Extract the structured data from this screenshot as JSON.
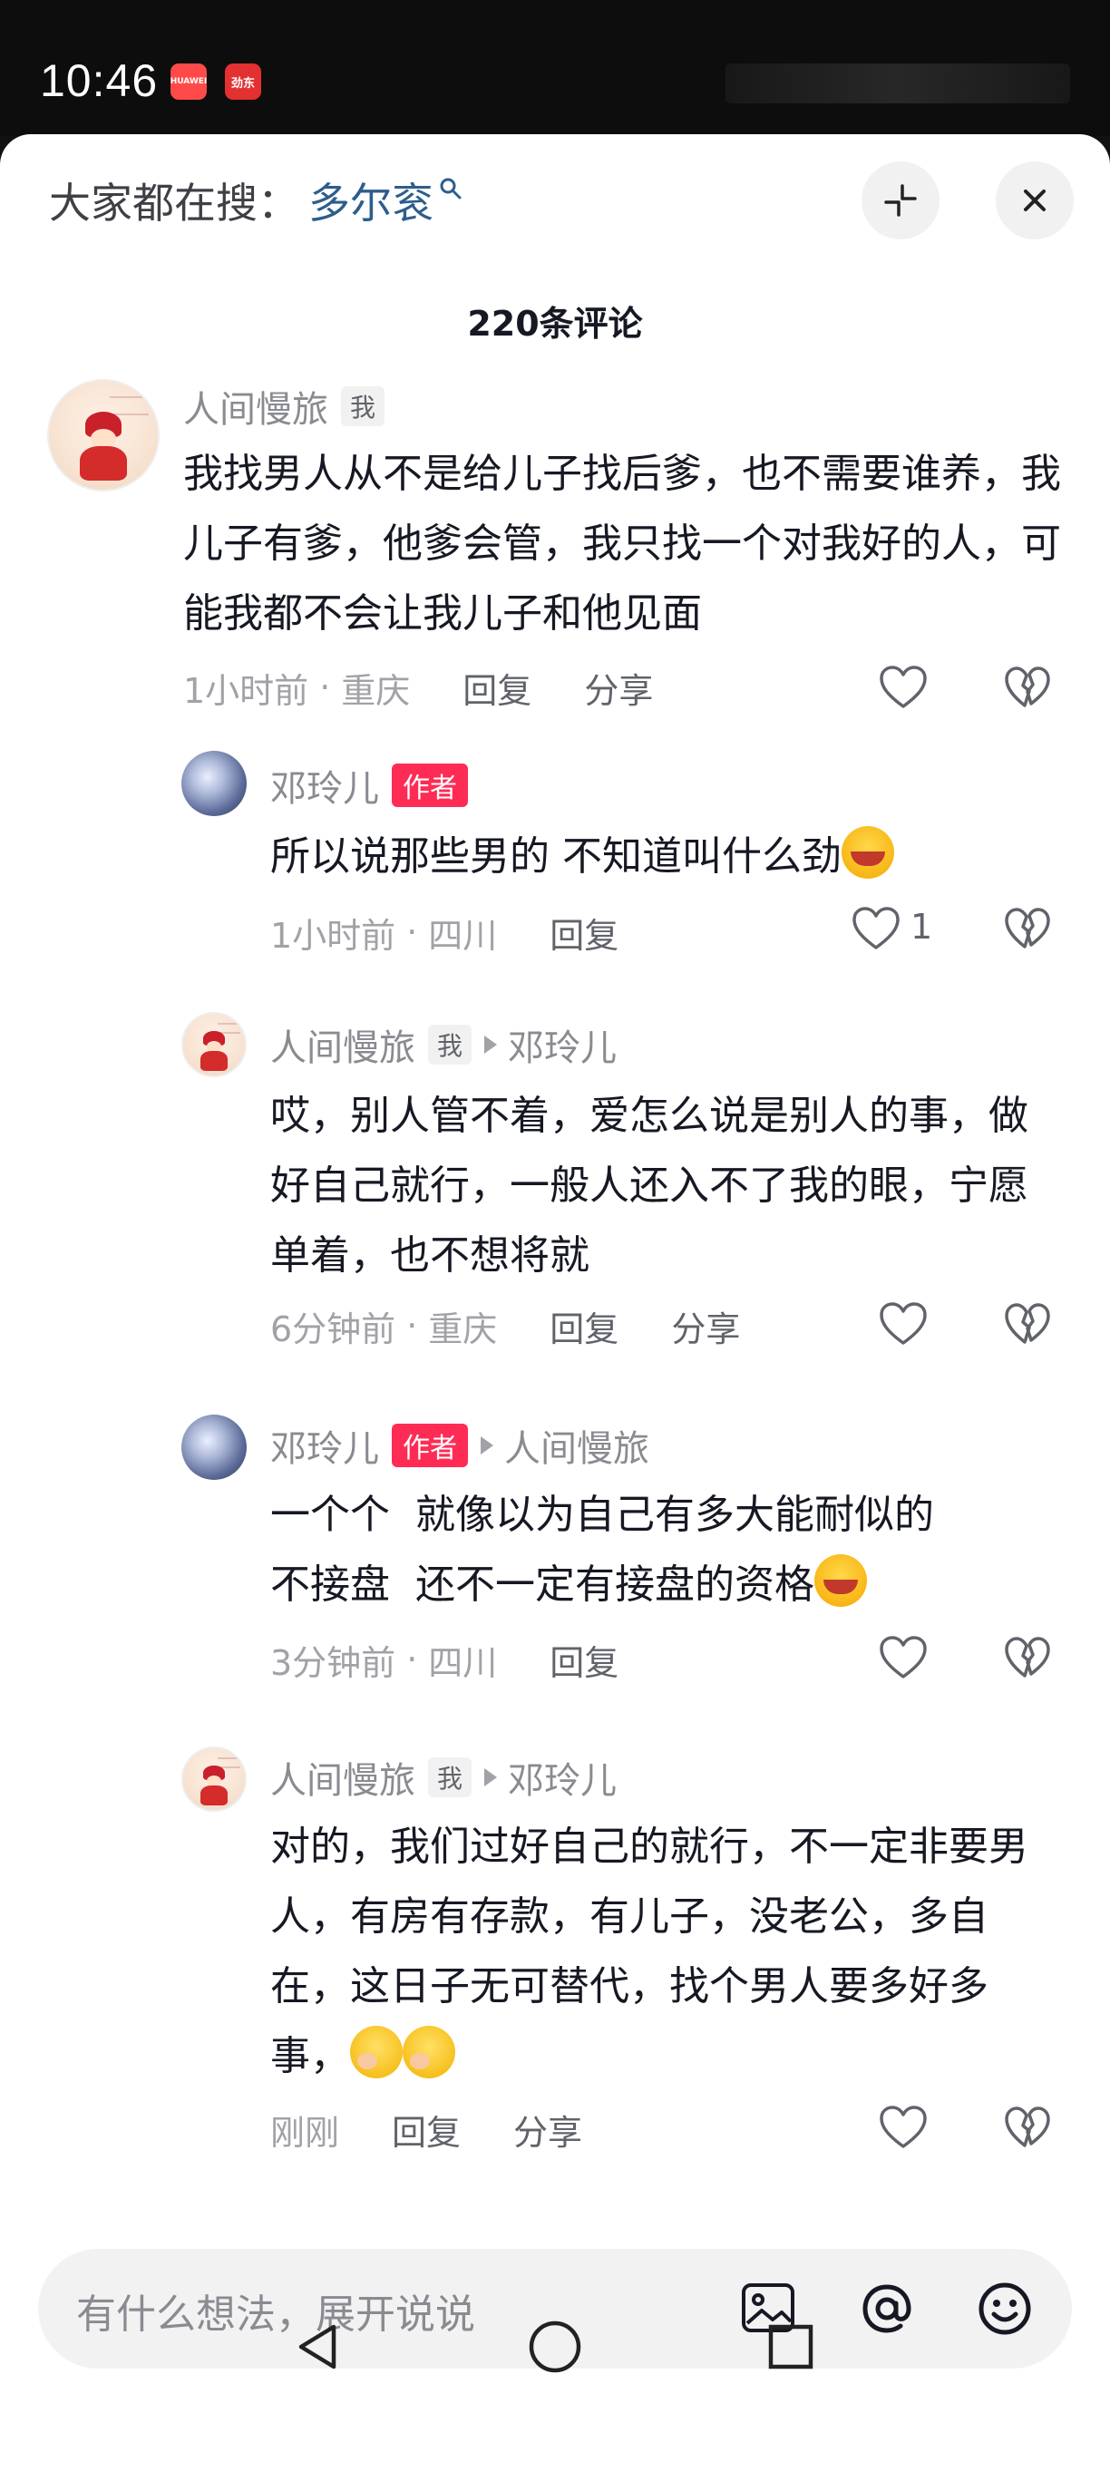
{
  "status_bar": {
    "time": "10:46",
    "app_icon_1": "HUAWEI",
    "app_icon_2": "劲东"
  },
  "search": {
    "prefix": "大家都在搜：",
    "term": "多尔衮"
  },
  "comment_count": "220条评论",
  "comments": [
    {
      "user": "人间慢旅",
      "tag": "我",
      "text": "我找男人从不是给儿子找后爹，也不需要谁养，我儿子有爹，他爹会管，我只找一个对我好的人，可能我都不会让我儿子和他见面",
      "time": "1小时前",
      "sep": "·",
      "location": "重庆",
      "reply": "回复",
      "share": "分享"
    },
    {
      "user": "邓玲儿",
      "tag": "作者",
      "text": "所以说那些男的 不知道叫什么劲",
      "time": "1小时前",
      "sep": "·",
      "location": "四川",
      "reply": "回复",
      "likes": "1"
    },
    {
      "user": "人间慢旅",
      "tag": "我",
      "reply_to": "邓玲儿",
      "text": "哎，别人管不着，爱怎么说是别人的事，做好自己就行，一般人还入不了我的眼，宁愿单着，也不想将就",
      "time": "6分钟前",
      "sep": "·",
      "location": "重庆",
      "reply": "回复",
      "share": "分享"
    },
    {
      "user": "邓玲儿",
      "tag": "作者",
      "reply_to": "人间慢旅",
      "text_line1": "一个个  就像以为自己有多大能耐似的",
      "text_line2": "不接盘  还不一定有接盘的资格",
      "time": "3分钟前",
      "sep": "·",
      "location": "四川",
      "reply": "回复"
    },
    {
      "user": "人间慢旅",
      "tag": "我",
      "reply_to": "邓玲儿",
      "text": "对的，我们过好自己的就行，不一定非要男人，有房有存款，有儿子，没老公，多自在，这日子无可替代，找个男人要多好多事，",
      "time": "刚刚",
      "reply": "回复",
      "share": "分享"
    }
  ],
  "input": {
    "placeholder": "有什么想法，展开说说"
  },
  "icons": {
    "search": "search-icon",
    "collapse": "collapse-icon",
    "close": "close-icon",
    "like": "heart-icon",
    "dislike": "broken-heart-icon",
    "image": "image-icon",
    "mention": "at-icon",
    "emoji": "emoji-icon",
    "nav_back": "back-triangle-icon",
    "nav_home": "home-circle-icon",
    "nav_recent": "recents-square-icon"
  },
  "colors": {
    "author_tag": "#fe2c55",
    "search_term": "#2d5d8c",
    "name_gray": "#8a8b91"
  }
}
